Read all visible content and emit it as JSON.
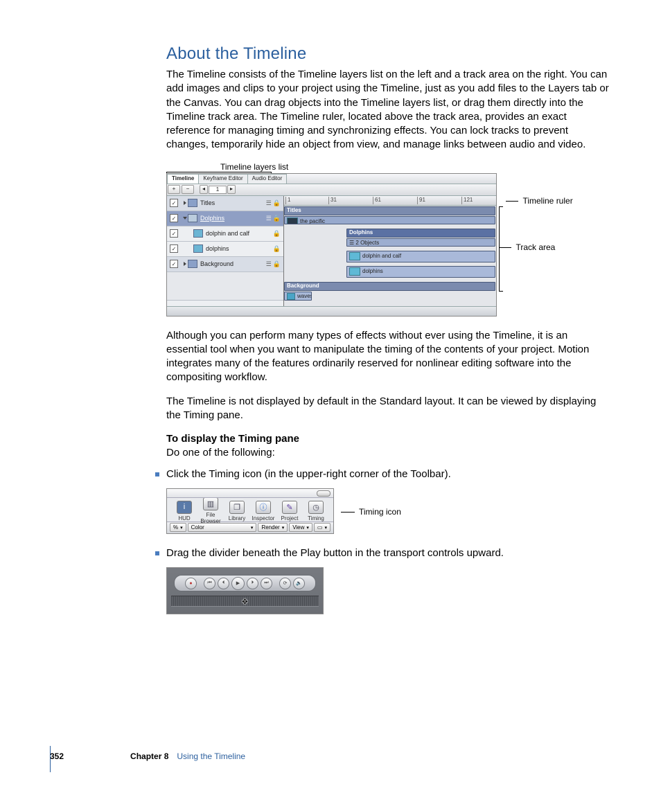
{
  "heading": "About the Timeline",
  "para1": "The Timeline consists of the Timeline layers list on the left and a track area on the right. You can add images and clips to your project using the Timeline, just as you add files to the Layers tab or the Canvas. You can drag objects into the Timeline layers list, or drag them directly into the Timeline track area. The Timeline ruler, located above the track area, provides an exact reference for managing timing and synchronizing effects. You can lock tracks to prevent changes, temporarily hide an object from view, and manage links between audio and video.",
  "callouts": {
    "layers_list": "Timeline layers list",
    "ruler": "Timeline ruler",
    "track_area": "Track area",
    "timing_icon": "Timing icon"
  },
  "timeline": {
    "tabs": [
      "Timeline",
      "Keyframe Editor",
      "Audio Editor"
    ],
    "frame_value": "1",
    "ruler_ticks": [
      "1",
      "31",
      "61",
      "91",
      "121"
    ],
    "layers": [
      {
        "name": "Titles",
        "type": "group",
        "expand": "right"
      },
      {
        "name": "Dolphins",
        "type": "group_sel",
        "expand": "down"
      },
      {
        "name": "dolphin and calf",
        "type": "child"
      },
      {
        "name": "dolphins",
        "type": "child"
      },
      {
        "name": "Background",
        "type": "group",
        "expand": "right"
      }
    ],
    "bars": {
      "titles_header": "Titles",
      "titles_clip": "the pacific",
      "dolphins_header": "Dolphins",
      "dolphins_sub": "2 Objects",
      "dolphin_calf": "dolphin and calf",
      "dolphins_clip": "dolphins",
      "background_header": "Background",
      "waves": "waves"
    }
  },
  "para2": "Although you can perform many types of effects without ever using the Timeline, it is an essential tool when you want to manipulate the timing of the contents of your project. Motion integrates many of the features ordinarily reserved for nonlinear editing software into the compositing workflow.",
  "para3": "The Timeline is not displayed by default in the Standard layout. It can be viewed by displaying the Timing pane.",
  "steps_heading": "To display the Timing pane",
  "steps_sub": "Do one of the following:",
  "bullet1": "Click the Timing icon (in the upper-right corner of the Toolbar).",
  "bullet2": "Drag the divider beneath the Play button in the transport controls upward.",
  "toolbar_items": [
    {
      "label": "HUD",
      "glyph": "i"
    },
    {
      "label": "File Browser",
      "glyph": "▥"
    },
    {
      "label": "Library",
      "glyph": "❐"
    },
    {
      "label": "Inspector",
      "glyph": "ⓘ"
    },
    {
      "label": "Project",
      "glyph": "✎"
    },
    {
      "label": "Timing",
      "glyph": "◷"
    }
  ],
  "toolbar_bottom": {
    "pct": "%",
    "color": "Color",
    "render": "Render",
    "view": "View"
  },
  "footer": {
    "page": "352",
    "chapter_label": "Chapter 8",
    "chapter_title": "Using the Timeline"
  }
}
